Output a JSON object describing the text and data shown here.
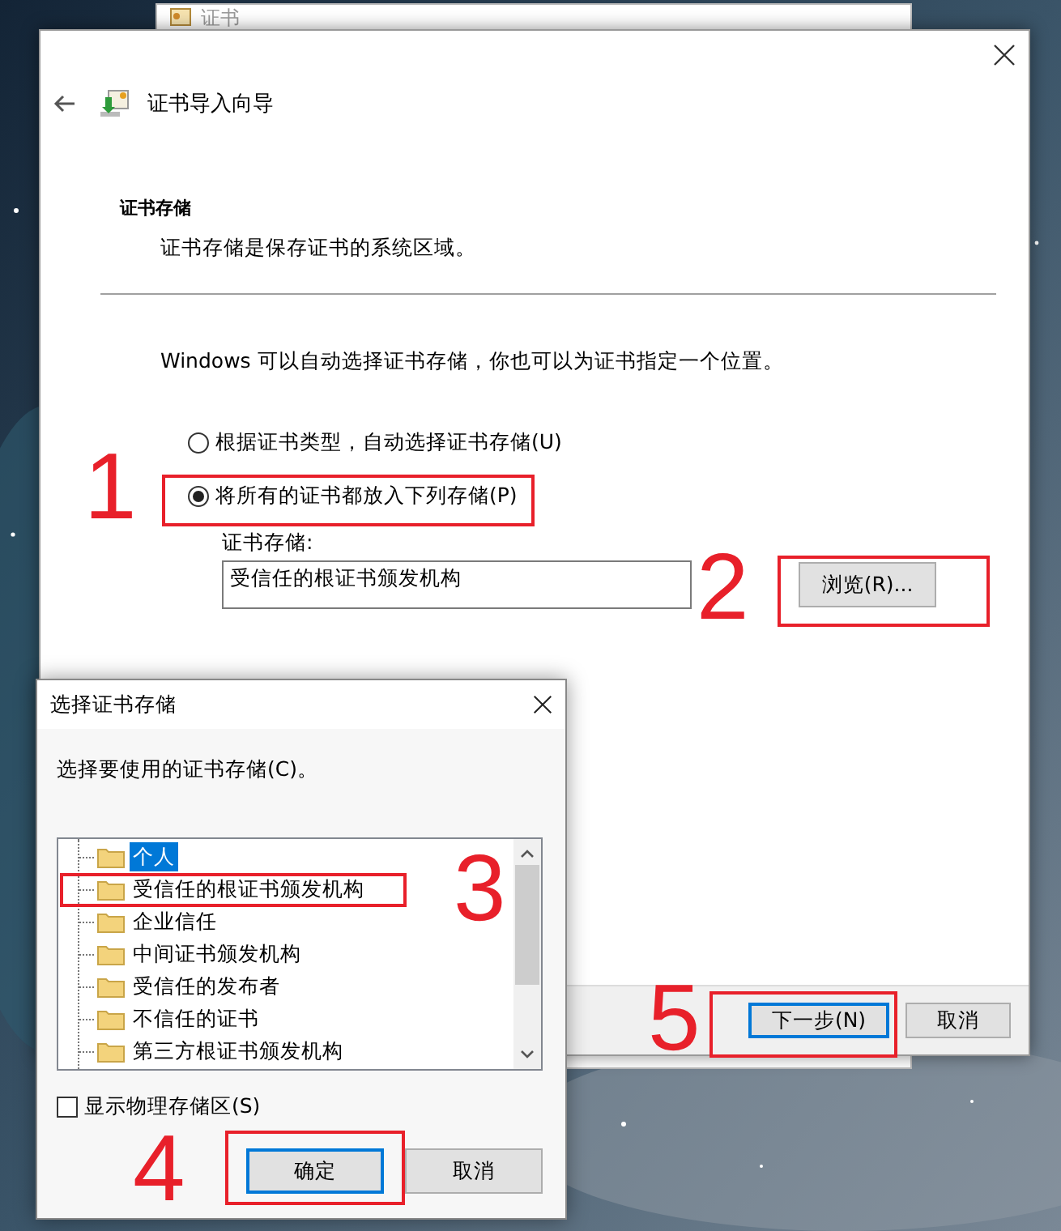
{
  "back_window": {
    "title": "证书"
  },
  "wizard": {
    "title": "证书导入向导",
    "section_title": "证书存储",
    "section_description": "证书存储是保存证书的系统区域。",
    "intro": "Windows 可以自动选择证书存储，你也可以为证书指定一个位置。",
    "options": [
      {
        "label": "根据证书类型，自动选择证书存储(U)",
        "selected": false
      },
      {
        "label": "将所有的证书都放入下列存储(P)",
        "selected": true
      }
    ],
    "store_label": "证书存储:",
    "store_value": "受信任的根证书颁发机构",
    "browse_button": "浏览(R)...",
    "buttons": [
      {
        "label": "下一步(N)",
        "default": true
      },
      {
        "label": "取消",
        "default": false
      }
    ]
  },
  "store_dialog": {
    "title": "选择证书存储",
    "prompt": "选择要使用的证书存储(C)。",
    "stores": [
      {
        "label": "个人",
        "selected": true
      },
      {
        "label": "受信任的根证书颁发机构",
        "selected": false
      },
      {
        "label": "企业信任",
        "selected": false
      },
      {
        "label": "中间证书颁发机构",
        "selected": false
      },
      {
        "label": "受信任的发布者",
        "selected": false
      },
      {
        "label": "不信任的证书",
        "selected": false
      },
      {
        "label": "第三方根证书颁发机构",
        "selected": false
      }
    ],
    "show_physical": {
      "label": "显示物理存储区(S)",
      "checked": false
    },
    "buttons": [
      {
        "label": "确定",
        "default": true
      },
      {
        "label": "取消",
        "default": false
      }
    ]
  },
  "annotations": [
    {
      "label": "1"
    },
    {
      "label": "2"
    },
    {
      "label": "3"
    },
    {
      "label": "4"
    },
    {
      "label": "5"
    }
  ]
}
